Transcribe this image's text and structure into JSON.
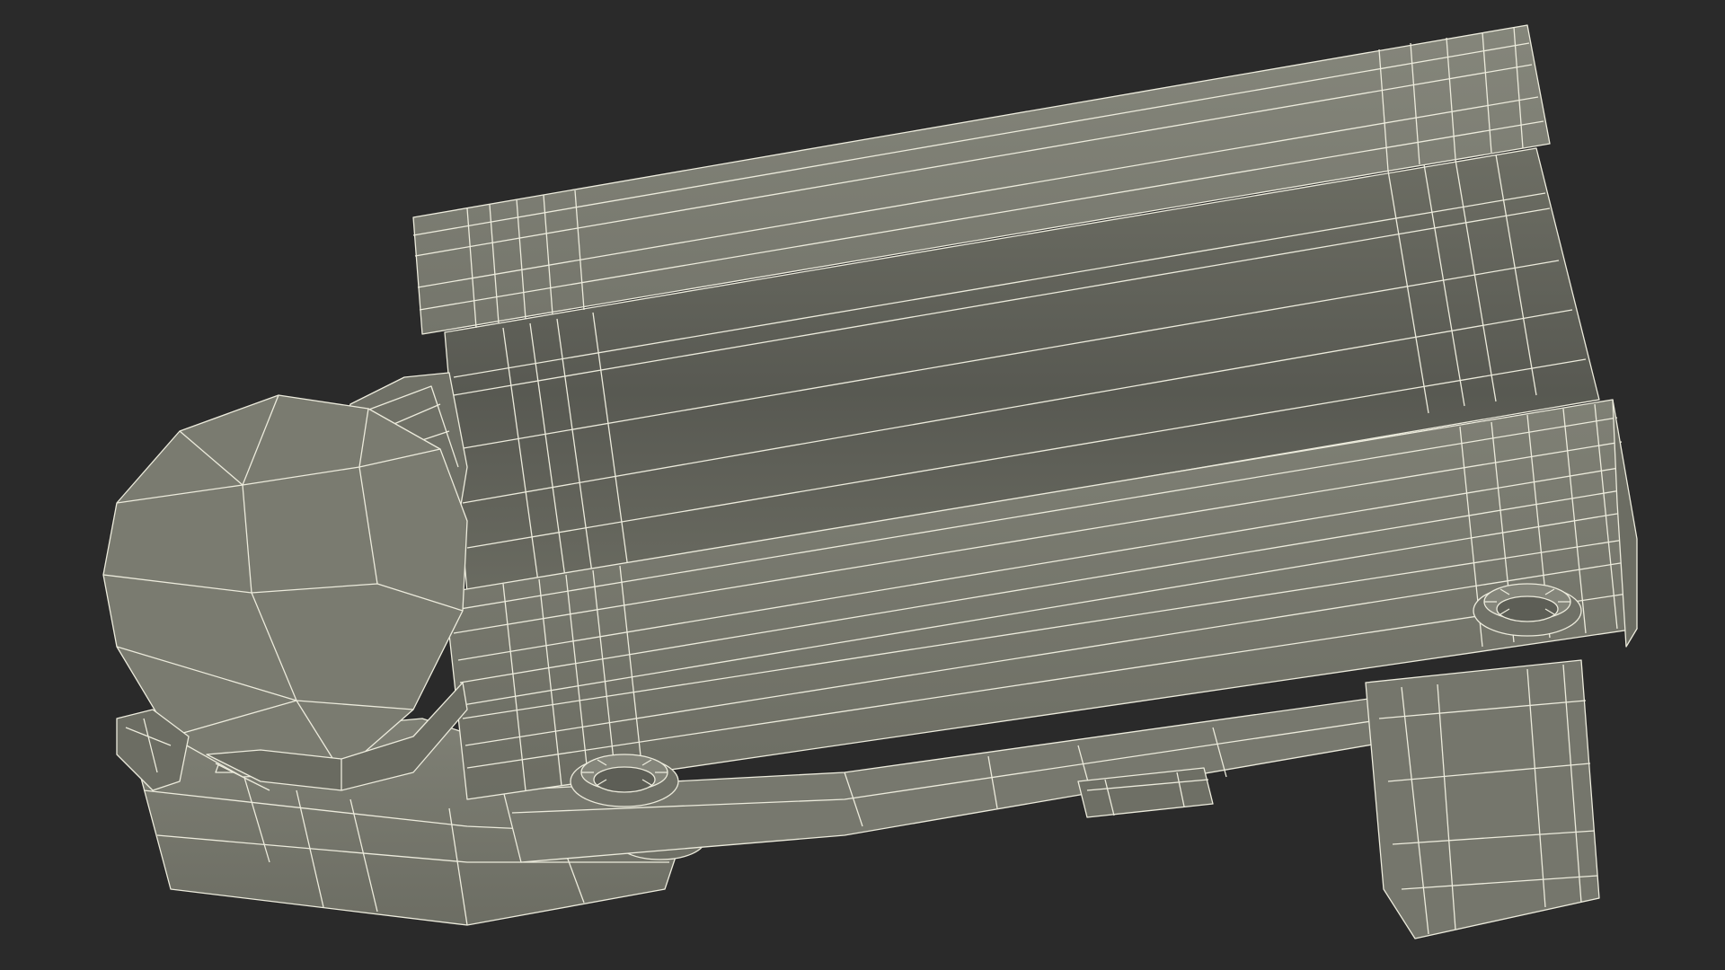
{
  "scene": {
    "background_color": "#2a2a2a",
    "model_fill_color": "#7b7c71",
    "model_shadow_color": "#5c5d55",
    "wire_color": "#ecebdc"
  }
}
